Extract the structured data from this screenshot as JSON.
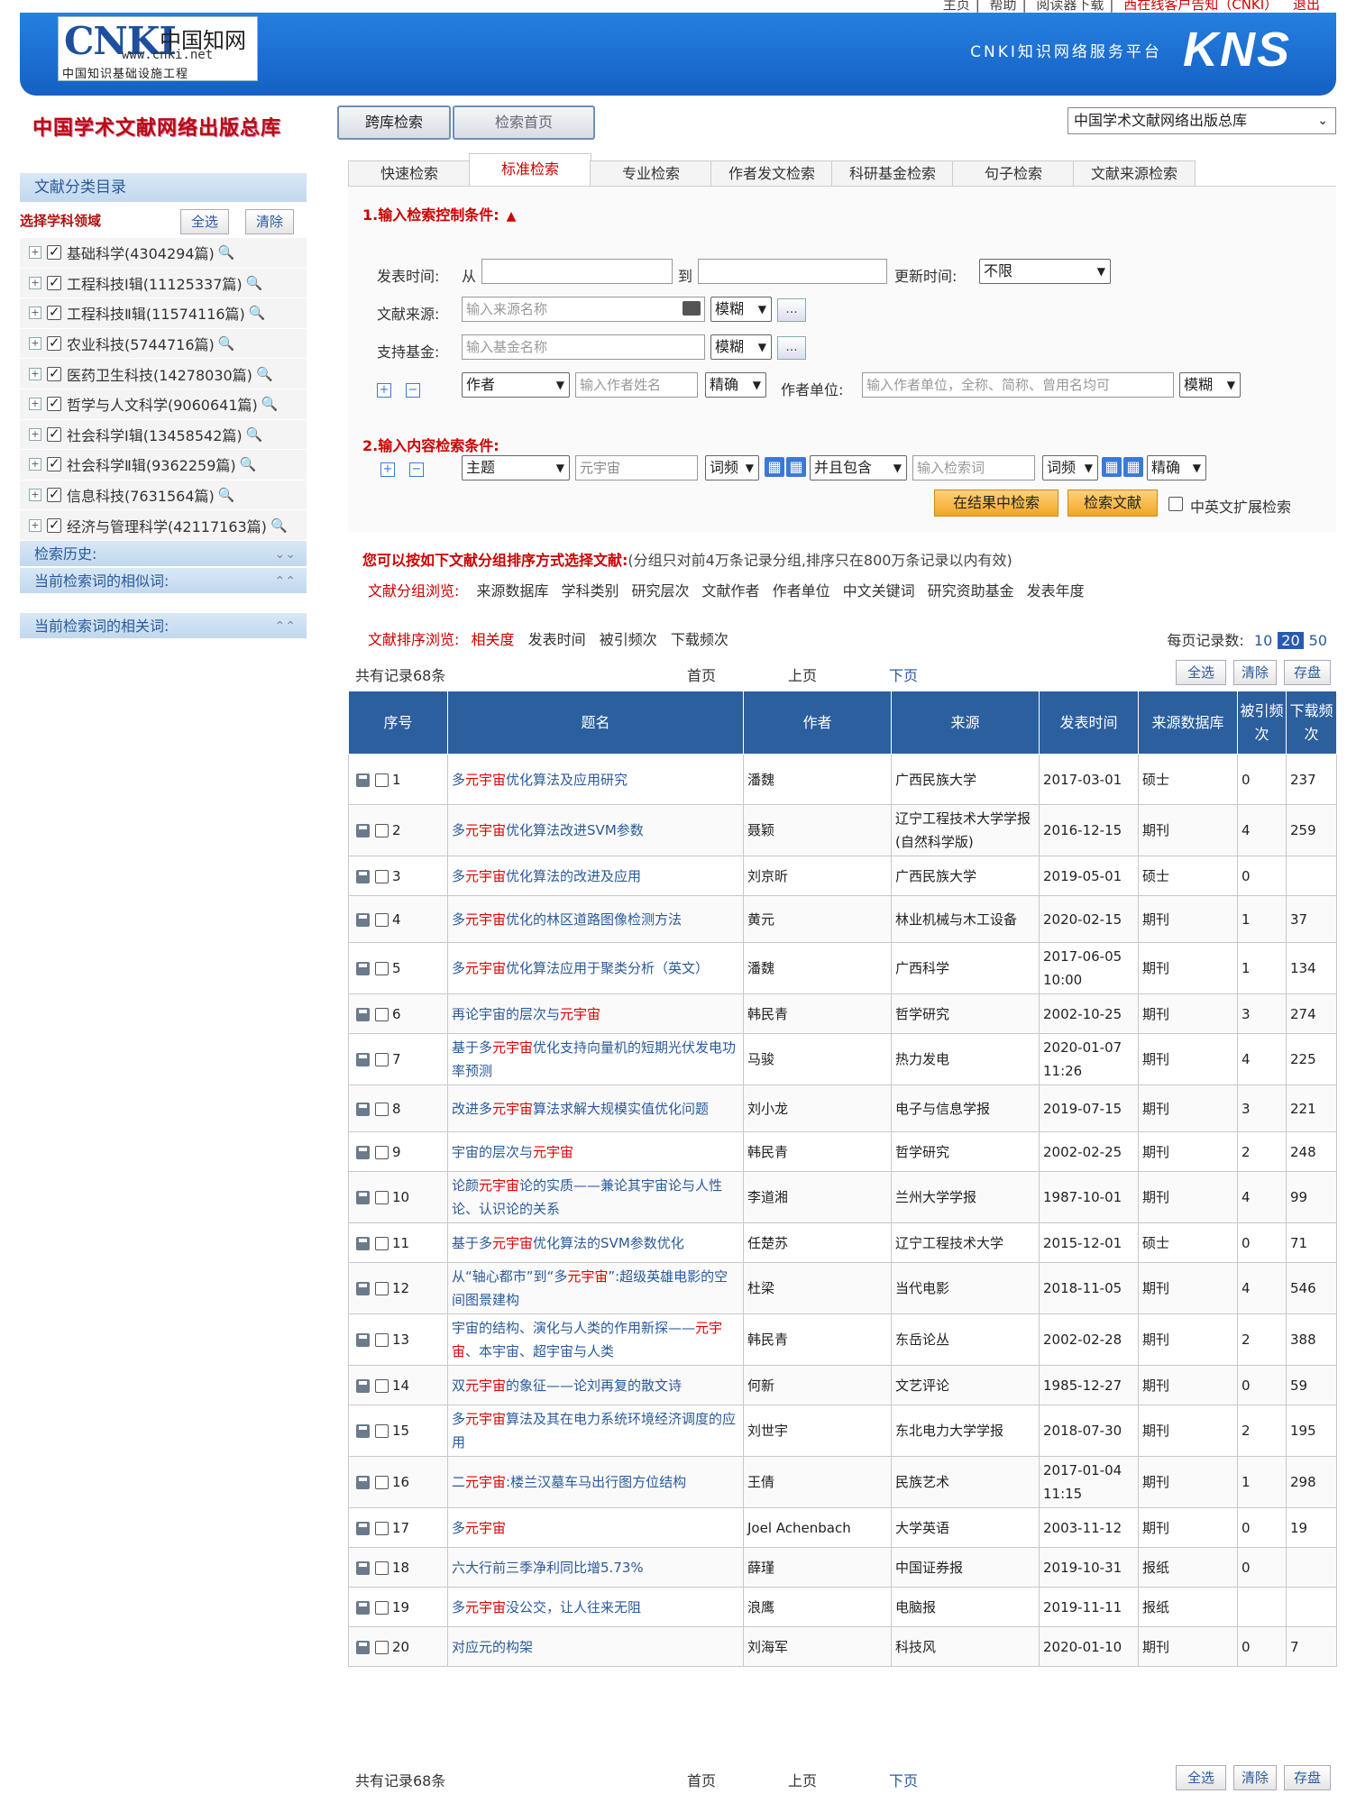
{
  "top_links": [
    "主页",
    "帮助",
    "阅读器下载",
    "西在线客户告知（CNKI）",
    "退出"
  ],
  "logo": {
    "brand": "CNKI",
    "cn": "中国知网",
    "url": "www.cnki.net",
    "subtitle": "中国知识基础设施工程"
  },
  "banner": {
    "platform": "CNKI知识网络服务平台",
    "kns": "KNS"
  },
  "db_title": "中国学术文献网络出版总库",
  "nav_buttons": [
    "跨库检索",
    "检索首页"
  ],
  "db_select": "中国学术文献网络出版总库",
  "sidebar": {
    "header": "文献分类目录",
    "select_label": "选择学科领域",
    "select_all": "全选",
    "clear": "清除",
    "categories": [
      "基础科学(4304294篇)",
      "工程科技Ⅰ辑(11125337篇)",
      "工程科技Ⅱ辑(11574116篇)",
      "农业科技(5744716篇)",
      "医药卫生科技(14278030篇)",
      "哲学与人文科学(9060641篇)",
      "社会科学Ⅰ辑(13458542篇)",
      "社会科学Ⅱ辑(9362259篇)",
      "信息科技(7631564篇)",
      "经济与管理科学(42117163篇)"
    ],
    "history": "检索历史:",
    "similar": "当前检索词的相似词:",
    "related": "当前检索词的相关词:"
  },
  "search_tabs": [
    "快速检索",
    "标准检索",
    "专业检索",
    "作者发文检索",
    "科研基金检索",
    "句子检索",
    "文献来源检索"
  ],
  "control": {
    "title": "1.输入检索控制条件:",
    "pub_time": "发表时间:",
    "from": "从",
    "to": "到",
    "update_time": "更新时间:",
    "update_value": "不限",
    "source_label": "文献来源:",
    "source_ph": "输入来源名称",
    "fuzzy": "模糊",
    "fund_label": "支持基金:",
    "fund_ph": "输入基金名称",
    "author_field": "作者",
    "author_ph": "输入作者姓名",
    "exact": "精确",
    "org_label": "作者单位:",
    "org_ph": "输入作者单位，全称、简称、曾用名均可",
    "dots": "..."
  },
  "content": {
    "title": "2.输入内容检索条件:",
    "field": "主题",
    "term": "元宇宙",
    "freq": "词频",
    "logic": "并且包含",
    "term2_ph": "输入检索词",
    "exact": "精确",
    "btn_in_results": "在结果中检索",
    "btn_search": "检索文献",
    "ext": "中英文扩展检索"
  },
  "grouping": {
    "title": "您可以按如下文献分组排序方式选择文献:",
    "note": "(分组只对前4万条记录分组,排序只在800万条记录以内有效)",
    "group_label": "文献分组浏览:",
    "groups": [
      "来源数据库",
      "学科类别",
      "研究层次",
      "文献作者",
      "作者单位",
      "中文关键词",
      "研究资助基金",
      "发表年度"
    ],
    "sort_label": "文献排序浏览:",
    "sorts": [
      "相关度",
      "发表时间",
      "被引频次",
      "下载频次"
    ]
  },
  "per_page": {
    "label": "每页记录数:",
    "options": [
      "10",
      "20",
      "50"
    ]
  },
  "pager": {
    "count": "共有记录68条",
    "first": "首页",
    "prev": "上页",
    "next": "下页",
    "select_all": "全选",
    "clear": "清除",
    "save": "存盘"
  },
  "columns": [
    "序号",
    "题名",
    "作者",
    "来源",
    "发表时间",
    "来源数据库",
    "被引频次",
    "下载频次"
  ],
  "rows": [
    {
      "n": "1",
      "pre": "多",
      "hl": "元宇宙",
      "post": "优化算法及应用研究",
      "author": "潘魏",
      "source": "广西民族大学",
      "date": "2017-03-01",
      "db": "硕士",
      "cited": "0",
      "dl": "237"
    },
    {
      "n": "2",
      "pre": "多",
      "hl": "元宇宙",
      "post": "优化算法改进SVM参数",
      "author": "聂颖",
      "source": "辽宁工程技术大学学报(自然科学版)",
      "date": "2016-12-15",
      "db": "期刊",
      "cited": "4",
      "dl": "259"
    },
    {
      "n": "3",
      "pre": "多",
      "hl": "元宇宙",
      "post": "优化算法的改进及应用",
      "author": "刘京昕",
      "source": "广西民族大学",
      "date": "2019-05-01",
      "db": "硕士",
      "cited": "0",
      "dl": ""
    },
    {
      "n": "4",
      "pre": "多",
      "hl": "元宇宙",
      "post": "优化的林区道路图像检测方法",
      "author": "黄元",
      "source": "林业机械与木工设备",
      "date": "2020-02-15",
      "db": "期刊",
      "cited": "1",
      "dl": "37"
    },
    {
      "n": "5",
      "pre": "多",
      "hl": "元宇宙",
      "post": "优化算法应用于聚类分析（英文）",
      "author": "潘魏",
      "source": "广西科学",
      "date": "2017-06-05 10:00",
      "db": "期刊",
      "cited": "1",
      "dl": "134"
    },
    {
      "n": "6",
      "pre": "再论宇宙的层次与",
      "hl": "元宇宙",
      "post": "",
      "author": "韩民青",
      "source": "哲学研究",
      "date": "2002-10-25",
      "db": "期刊",
      "cited": "3",
      "dl": "274"
    },
    {
      "n": "7",
      "pre": "基于多",
      "hl": "元宇宙",
      "post": "优化支持向量机的短期光伏发电功率预测",
      "author": "马骏",
      "source": "热力发电",
      "date": "2020-01-07 11:26",
      "db": "期刊",
      "cited": "4",
      "dl": "225"
    },
    {
      "n": "8",
      "pre": "改进多",
      "hl": "元宇宙",
      "post": "算法求解大规模实值优化问题",
      "author": "刘小龙",
      "source": "电子与信息学报",
      "date": "2019-07-15",
      "db": "期刊",
      "cited": "3",
      "dl": "221"
    },
    {
      "n": "9",
      "pre": "宇宙的层次与",
      "hl": "元宇宙",
      "post": "",
      "author": "韩民青",
      "source": "哲学研究",
      "date": "2002-02-25",
      "db": "期刊",
      "cited": "2",
      "dl": "248"
    },
    {
      "n": "10",
      "pre": "论颜",
      "hl": "元宇宙",
      "post": "论的实质——兼论其宇宙论与人性论、认识论的关系",
      "author": "李道湘",
      "source": "兰州大学学报",
      "date": "1987-10-01",
      "db": "期刊",
      "cited": "4",
      "dl": "99"
    },
    {
      "n": "11",
      "pre": "基于多",
      "hl": "元宇宙",
      "post": "优化算法的SVM参数优化",
      "author": "任楚苏",
      "source": "辽宁工程技术大学",
      "date": "2015-12-01",
      "db": "硕士",
      "cited": "0",
      "dl": "71"
    },
    {
      "n": "12",
      "pre": "从“轴心都市”到“多",
      "hl": "元宇宙",
      "post": "”:超级英雄电影的空间图景建构",
      "author": "杜梁",
      "source": "当代电影",
      "date": "2018-11-05",
      "db": "期刊",
      "cited": "4",
      "dl": "546"
    },
    {
      "n": "13",
      "pre": "宇宙的结构、演化与人类的作用新探——",
      "hl": "元宇宙",
      "post": "、本宇宙、超宇宙与人类",
      "author": "韩民青",
      "source": "东岳论丛",
      "date": "2002-02-28",
      "db": "期刊",
      "cited": "2",
      "dl": "388"
    },
    {
      "n": "14",
      "pre": "双",
      "hl": "元宇宙",
      "post": "的象征——论刘再复的散文诗",
      "author": "何新",
      "source": "文艺评论",
      "date": "1985-12-27",
      "db": "期刊",
      "cited": "0",
      "dl": "59"
    },
    {
      "n": "15",
      "pre": "多",
      "hl": "元宇宙",
      "post": "算法及其在电力系统环境经济调度的应用",
      "author": "刘世宇",
      "source": "东北电力大学学报",
      "date": "2018-07-30",
      "db": "期刊",
      "cited": "2",
      "dl": "195"
    },
    {
      "n": "16",
      "pre": "二",
      "hl": "元宇宙",
      "post": ":楼兰汉墓车马出行图方位结构",
      "author": "王倩",
      "source": "民族艺术",
      "date": "2017-01-04 11:15",
      "db": "期刊",
      "cited": "1",
      "dl": "298"
    },
    {
      "n": "17",
      "pre": "多",
      "hl": "元宇宙",
      "post": "",
      "author": "Joel Achenbach",
      "source": "大学英语",
      "date": "2003-11-12",
      "db": "期刊",
      "cited": "0",
      "dl": "19"
    },
    {
      "n": "18",
      "pre": "六大行前三季净利同比增5.73%",
      "hl": "",
      "post": "",
      "author": "薛瑾",
      "source": "中国证券报",
      "date": "2019-10-31",
      "db": "报纸",
      "cited": "0",
      "dl": ""
    },
    {
      "n": "19",
      "pre": "多",
      "hl": "元宇宙",
      "post": "没公交，让人往来无阻",
      "author": "浪鹰",
      "source": "电脑报",
      "date": "2019-11-11",
      "db": "报纸",
      "cited": "",
      "dl": ""
    },
    {
      "n": "20",
      "pre": "对应元的构架",
      "hl": "",
      "post": "",
      "author": "刘海军",
      "source": "科技风",
      "date": "2020-01-10",
      "db": "期刊",
      "cited": "0",
      "dl": "7"
    }
  ]
}
